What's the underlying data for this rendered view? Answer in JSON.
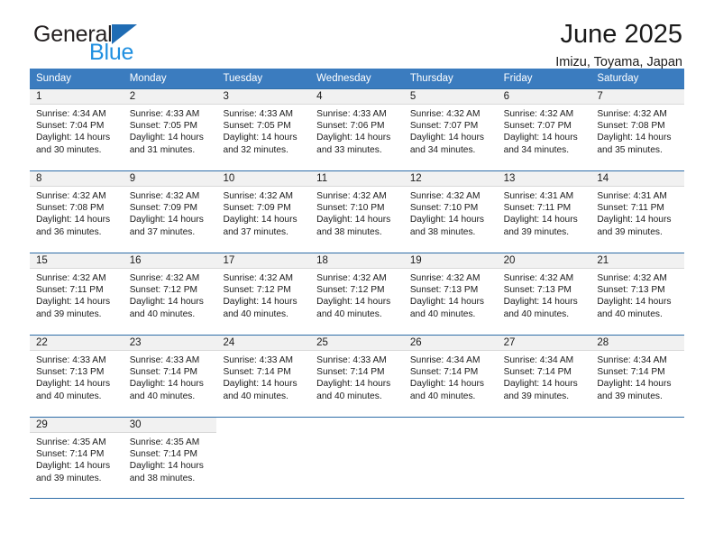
{
  "brand": {
    "name_part1": "General",
    "name_part2": "Blue",
    "triangle_color": "#1f6cb4",
    "blue_color": "#1f8fe0"
  },
  "header": {
    "title": "June 2025",
    "subtitle": "Imizu, Toyama, Japan"
  },
  "theme": {
    "header_bg": "#3b7cbf",
    "row_line": "#2e6da8",
    "day_band_bg": "#f1f1f1"
  },
  "weekdays": [
    "Sunday",
    "Monday",
    "Tuesday",
    "Wednesday",
    "Thursday",
    "Friday",
    "Saturday"
  ],
  "weeks": [
    [
      {
        "day": "1",
        "sunrise": "Sunrise: 4:34 AM",
        "sunset": "Sunset: 7:04 PM",
        "daylight": "Daylight: 14 hours and 30 minutes."
      },
      {
        "day": "2",
        "sunrise": "Sunrise: 4:33 AM",
        "sunset": "Sunset: 7:05 PM",
        "daylight": "Daylight: 14 hours and 31 minutes."
      },
      {
        "day": "3",
        "sunrise": "Sunrise: 4:33 AM",
        "sunset": "Sunset: 7:05 PM",
        "daylight": "Daylight: 14 hours and 32 minutes."
      },
      {
        "day": "4",
        "sunrise": "Sunrise: 4:33 AM",
        "sunset": "Sunset: 7:06 PM",
        "daylight": "Daylight: 14 hours and 33 minutes."
      },
      {
        "day": "5",
        "sunrise": "Sunrise: 4:32 AM",
        "sunset": "Sunset: 7:07 PM",
        "daylight": "Daylight: 14 hours and 34 minutes."
      },
      {
        "day": "6",
        "sunrise": "Sunrise: 4:32 AM",
        "sunset": "Sunset: 7:07 PM",
        "daylight": "Daylight: 14 hours and 34 minutes."
      },
      {
        "day": "7",
        "sunrise": "Sunrise: 4:32 AM",
        "sunset": "Sunset: 7:08 PM",
        "daylight": "Daylight: 14 hours and 35 minutes."
      }
    ],
    [
      {
        "day": "8",
        "sunrise": "Sunrise: 4:32 AM",
        "sunset": "Sunset: 7:08 PM",
        "daylight": "Daylight: 14 hours and 36 minutes."
      },
      {
        "day": "9",
        "sunrise": "Sunrise: 4:32 AM",
        "sunset": "Sunset: 7:09 PM",
        "daylight": "Daylight: 14 hours and 37 minutes."
      },
      {
        "day": "10",
        "sunrise": "Sunrise: 4:32 AM",
        "sunset": "Sunset: 7:09 PM",
        "daylight": "Daylight: 14 hours and 37 minutes."
      },
      {
        "day": "11",
        "sunrise": "Sunrise: 4:32 AM",
        "sunset": "Sunset: 7:10 PM",
        "daylight": "Daylight: 14 hours and 38 minutes."
      },
      {
        "day": "12",
        "sunrise": "Sunrise: 4:32 AM",
        "sunset": "Sunset: 7:10 PM",
        "daylight": "Daylight: 14 hours and 38 minutes."
      },
      {
        "day": "13",
        "sunrise": "Sunrise: 4:31 AM",
        "sunset": "Sunset: 7:11 PM",
        "daylight": "Daylight: 14 hours and 39 minutes."
      },
      {
        "day": "14",
        "sunrise": "Sunrise: 4:31 AM",
        "sunset": "Sunset: 7:11 PM",
        "daylight": "Daylight: 14 hours and 39 minutes."
      }
    ],
    [
      {
        "day": "15",
        "sunrise": "Sunrise: 4:32 AM",
        "sunset": "Sunset: 7:11 PM",
        "daylight": "Daylight: 14 hours and 39 minutes."
      },
      {
        "day": "16",
        "sunrise": "Sunrise: 4:32 AM",
        "sunset": "Sunset: 7:12 PM",
        "daylight": "Daylight: 14 hours and 40 minutes."
      },
      {
        "day": "17",
        "sunrise": "Sunrise: 4:32 AM",
        "sunset": "Sunset: 7:12 PM",
        "daylight": "Daylight: 14 hours and 40 minutes."
      },
      {
        "day": "18",
        "sunrise": "Sunrise: 4:32 AM",
        "sunset": "Sunset: 7:12 PM",
        "daylight": "Daylight: 14 hours and 40 minutes."
      },
      {
        "day": "19",
        "sunrise": "Sunrise: 4:32 AM",
        "sunset": "Sunset: 7:13 PM",
        "daylight": "Daylight: 14 hours and 40 minutes."
      },
      {
        "day": "20",
        "sunrise": "Sunrise: 4:32 AM",
        "sunset": "Sunset: 7:13 PM",
        "daylight": "Daylight: 14 hours and 40 minutes."
      },
      {
        "day": "21",
        "sunrise": "Sunrise: 4:32 AM",
        "sunset": "Sunset: 7:13 PM",
        "daylight": "Daylight: 14 hours and 40 minutes."
      }
    ],
    [
      {
        "day": "22",
        "sunrise": "Sunrise: 4:33 AM",
        "sunset": "Sunset: 7:13 PM",
        "daylight": "Daylight: 14 hours and 40 minutes."
      },
      {
        "day": "23",
        "sunrise": "Sunrise: 4:33 AM",
        "sunset": "Sunset: 7:14 PM",
        "daylight": "Daylight: 14 hours and 40 minutes."
      },
      {
        "day": "24",
        "sunrise": "Sunrise: 4:33 AM",
        "sunset": "Sunset: 7:14 PM",
        "daylight": "Daylight: 14 hours and 40 minutes."
      },
      {
        "day": "25",
        "sunrise": "Sunrise: 4:33 AM",
        "sunset": "Sunset: 7:14 PM",
        "daylight": "Daylight: 14 hours and 40 minutes."
      },
      {
        "day": "26",
        "sunrise": "Sunrise: 4:34 AM",
        "sunset": "Sunset: 7:14 PM",
        "daylight": "Daylight: 14 hours and 40 minutes."
      },
      {
        "day": "27",
        "sunrise": "Sunrise: 4:34 AM",
        "sunset": "Sunset: 7:14 PM",
        "daylight": "Daylight: 14 hours and 39 minutes."
      },
      {
        "day": "28",
        "sunrise": "Sunrise: 4:34 AM",
        "sunset": "Sunset: 7:14 PM",
        "daylight": "Daylight: 14 hours and 39 minutes."
      }
    ],
    [
      {
        "day": "29",
        "sunrise": "Sunrise: 4:35 AM",
        "sunset": "Sunset: 7:14 PM",
        "daylight": "Daylight: 14 hours and 39 minutes."
      },
      {
        "day": "30",
        "sunrise": "Sunrise: 4:35 AM",
        "sunset": "Sunset: 7:14 PM",
        "daylight": "Daylight: 14 hours and 38 minutes."
      },
      {
        "day": "",
        "sunrise": "",
        "sunset": "",
        "daylight": ""
      },
      {
        "day": "",
        "sunrise": "",
        "sunset": "",
        "daylight": ""
      },
      {
        "day": "",
        "sunrise": "",
        "sunset": "",
        "daylight": ""
      },
      {
        "day": "",
        "sunrise": "",
        "sunset": "",
        "daylight": ""
      },
      {
        "day": "",
        "sunrise": "",
        "sunset": "",
        "daylight": ""
      }
    ]
  ]
}
